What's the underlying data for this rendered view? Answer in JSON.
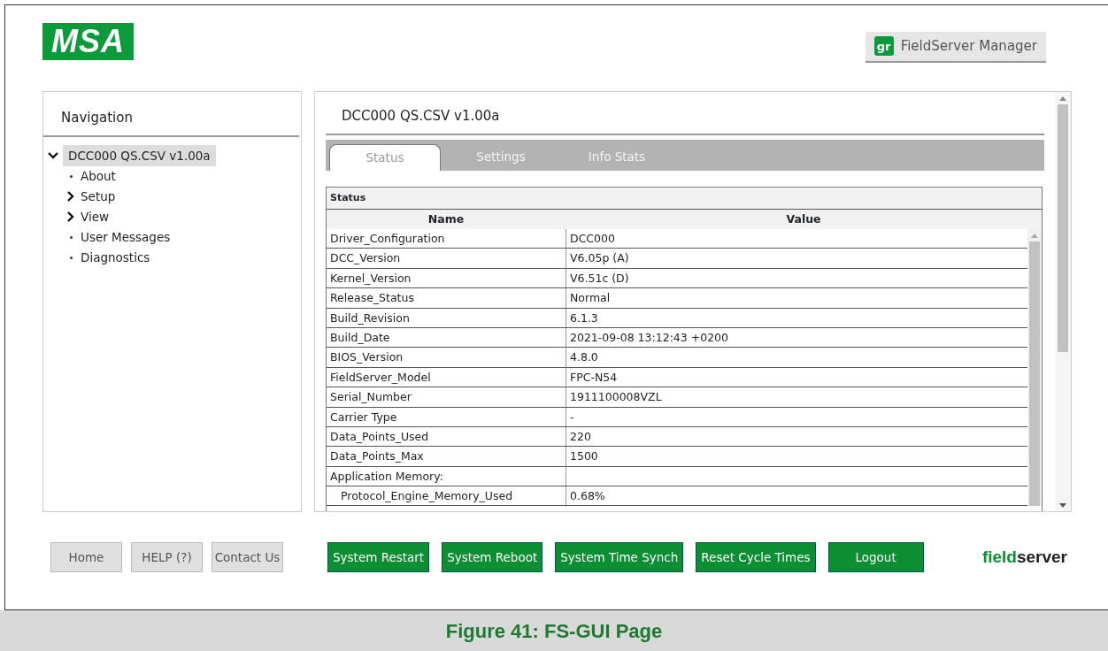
{
  "logo": {
    "text": "MSA"
  },
  "manager_button": {
    "icon_text": "gr",
    "label": "FieldServer Manager"
  },
  "navigation": {
    "title": "Navigation",
    "tree": [
      {
        "label": "DCC000 QS.CSV v1.00a",
        "selected": true,
        "expanded": true,
        "children": [
          {
            "label": "About"
          },
          {
            "label": "Setup",
            "expanded": false
          },
          {
            "label": "View",
            "expanded": false
          },
          {
            "label": "User Messages"
          },
          {
            "label": "Diagnostics"
          }
        ]
      }
    ]
  },
  "content": {
    "title": "DCC000 QS.CSV v1.00a",
    "tabs": [
      {
        "label": "Status",
        "selected": true
      },
      {
        "label": "Settings",
        "selected": false
      },
      {
        "label": "Info Stats",
        "selected": false
      }
    ],
    "table": {
      "caption": "Status",
      "columns": [
        "Name",
        "Value"
      ],
      "rows": [
        {
          "name": "Driver_Configuration",
          "value": "DCC000"
        },
        {
          "name": "DCC_Version",
          "value": "V6.05p (A)"
        },
        {
          "name": "Kernel_Version",
          "value": "V6.51c (D)"
        },
        {
          "name": "Release_Status",
          "value": "Normal"
        },
        {
          "name": "Build_Revision",
          "value": "6.1.3"
        },
        {
          "name": "Build_Date",
          "value": "2021-09-08 13:12:43 +0200"
        },
        {
          "name": "BIOS_Version",
          "value": "4.8.0"
        },
        {
          "name": "FieldServer_Model",
          "value": "FPC-N54"
        },
        {
          "name": "Serial_Number",
          "value": "1911100008VZL"
        },
        {
          "name": "Carrier Type",
          "value": "-"
        },
        {
          "name": "Data_Points_Used",
          "value": "220"
        },
        {
          "name": "Data_Points_Max",
          "value": "1500"
        },
        {
          "name": "Application Memory:",
          "children": [
            {
              "name": "Protocol_Engine_Memory_Used",
              "value": "0.68%"
            }
          ]
        }
      ]
    }
  },
  "footer_buttons": [
    {
      "label": "Home",
      "kind": "plain"
    },
    {
      "label": "HELP (?)",
      "kind": "plain"
    },
    {
      "label": "Contact Us",
      "kind": "plain"
    },
    {
      "label": "System Restart",
      "kind": "action"
    },
    {
      "label": "System Reboot",
      "kind": "action"
    },
    {
      "label": "System Time Synch",
      "kind": "action"
    },
    {
      "label": "Reset Cycle Times",
      "kind": "action"
    },
    {
      "label": "Logout",
      "kind": "action"
    }
  ],
  "brand": {
    "first": "field",
    "second": "server"
  },
  "caption": "Figure 41: FS-GUI Page"
}
